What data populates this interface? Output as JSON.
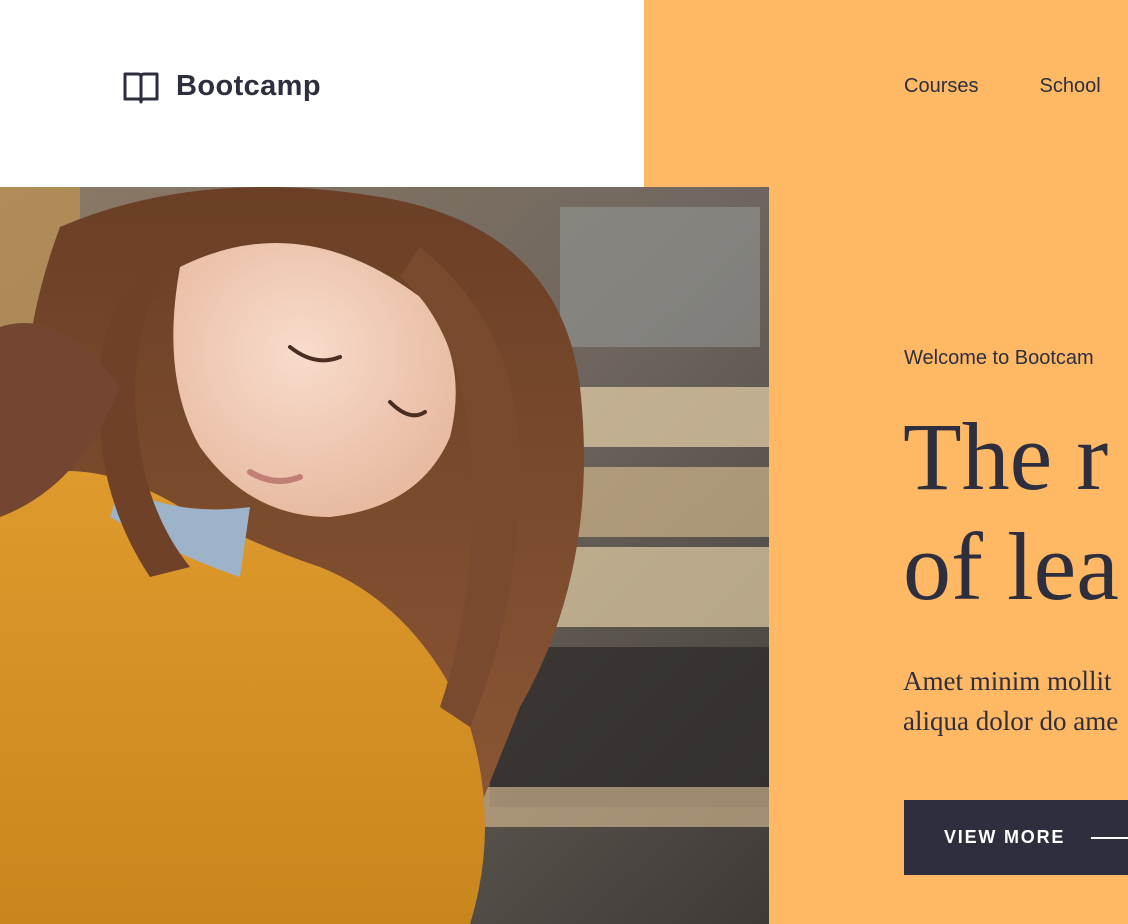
{
  "brand": {
    "name": "Bootcamp",
    "icon": "open-book-icon"
  },
  "nav": {
    "items": [
      "Courses",
      "School"
    ]
  },
  "hero": {
    "eyebrow": "Welcome to Bootcam",
    "headline_line1": "The r",
    "headline_line2": "of lea",
    "description_line1": "Amet minim mollit",
    "description_line2": "aliqua dolor do ame",
    "cta_label": "VIEW MORE",
    "cta_icon": "arrow-line-icon"
  },
  "colors": {
    "accent_background": "#FFB864",
    "text_dark": "#2E2F3E",
    "button_background": "#2E2F3E",
    "header_background": "#FFFFFF"
  }
}
